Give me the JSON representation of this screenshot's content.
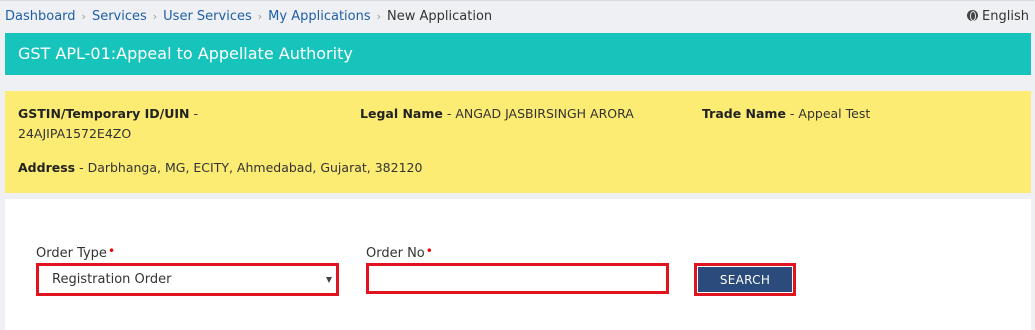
{
  "breadcrumb": {
    "items": [
      "Dashboard",
      "Services",
      "User Services",
      "My Applications"
    ],
    "current": "New Application",
    "separator": "›"
  },
  "language": {
    "label": "English",
    "icon": "globe-icon"
  },
  "page_title": "GST APL-01:Appeal to Appellate Authority",
  "taxpayer": {
    "gstin_label": "GSTIN/Temporary ID/UIN",
    "gstin_value": "24AJIPA1572E4ZO",
    "legal_name_label": "Legal Name",
    "legal_name_value": "ANGAD JASBIRSINGH ARORA",
    "trade_name_label": "Trade Name",
    "trade_name_value": "Appeal Test",
    "address_label": "Address",
    "address_value": "Darbhanga, MG, ECITY, Ahmedabad, Gujarat, 382120",
    "dash": " - "
  },
  "form": {
    "order_type_label": "Order Type",
    "order_type_selected": "Registration Order",
    "order_no_label": "Order No",
    "order_no_value": "",
    "required_mark": "•",
    "search_label": "SEARCH"
  },
  "colors": {
    "title_bar": "#17c4bb",
    "info_box": "#fcec74",
    "highlight_border": "#e0141e",
    "search_button": "#2a4b7c",
    "link": "#1f5fa6"
  }
}
